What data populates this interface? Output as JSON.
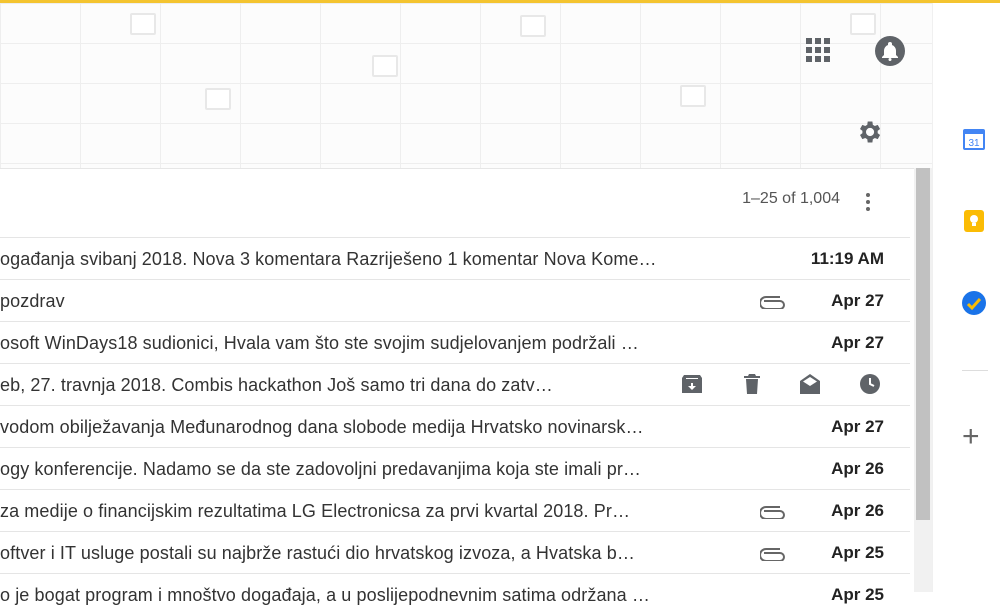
{
  "colors": {
    "accent": "#f4c430",
    "icon": "#5f6368",
    "calendar": "#4285f4",
    "keep": "#fbbc04",
    "tasks": "#1a73e8"
  },
  "header": {
    "icons": [
      "apps-grid-icon",
      "notifications-bell-icon",
      "user-avatar",
      "settings-gear-icon"
    ]
  },
  "side_panel": {
    "calendar_label": "31",
    "icons": [
      "calendar-icon",
      "keep-icon",
      "tasks-icon",
      "add-icon"
    ],
    "add_label": "+"
  },
  "toolbar": {
    "pagination": "1–25 of 1,004"
  },
  "emails": [
    {
      "snippet": "ogađanja svibanj 2018. Nova 3 komentara Razriješeno 1 komentar Nova Kome…",
      "date": "11:19 AM",
      "attachment": false
    },
    {
      "snippet": "pozdrav",
      "date": "Apr 27",
      "attachment": true
    },
    {
      "snippet": "osoft WinDays18 sudionici, Hvala vam što ste svojim sudjelovanjem podržali …",
      "date": "Apr 27",
      "attachment": false
    },
    {
      "snippet": "eb, 27. travnja 2018. Combis hackathon Još samo tri dana do zatv…",
      "date": "",
      "attachment": false,
      "hover": true
    },
    {
      "snippet": "vodom obilježavanja Međunarodnog dana slobode medija Hrvatsko novinarsk…",
      "date": "Apr 27",
      "attachment": false
    },
    {
      "snippet": "ogy konferencije. Nadamo se da ste zadovoljni predavanjima koja ste imali pr…",
      "date": "Apr 26",
      "attachment": false
    },
    {
      "snippet": " za medije o financijskim rezultatima LG Electronicsa za prvi kvartal 2018. Pr…",
      "date": "Apr 26",
      "attachment": true
    },
    {
      "snippet": "oftver i IT usluge postali su najbrže rastući dio hrvatskog izvoza, a Hvatska b…",
      "date": "Apr 25",
      "attachment": true
    },
    {
      "snippet": "o je bogat program i mnoštvo događaja, a u poslijepodnevnim satima održana …",
      "date": "Apr 25",
      "attachment": false
    }
  ],
  "hover_actions": [
    "archive-icon",
    "delete-icon",
    "mark-as-read-icon",
    "snooze-icon"
  ]
}
